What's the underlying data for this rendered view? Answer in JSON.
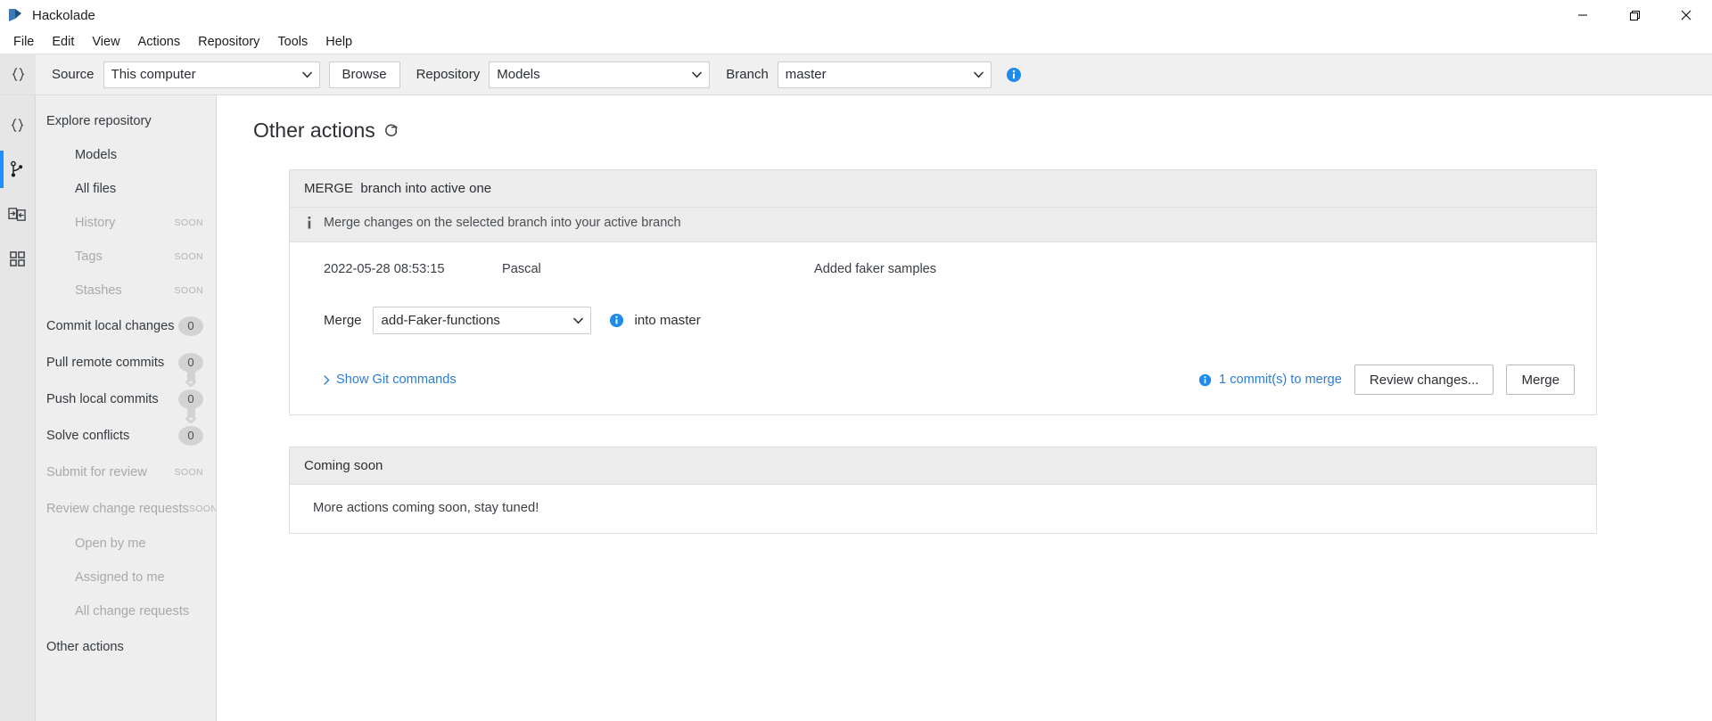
{
  "window": {
    "title": "Hackolade",
    "logo_icon": "hackolade-logo-icon",
    "controls": {
      "minimize": "minimize-icon",
      "maximize": "restore-icon",
      "close": "close-icon"
    }
  },
  "menubar": {
    "items": [
      {
        "label": "File"
      },
      {
        "label": "Edit"
      },
      {
        "label": "View"
      },
      {
        "label": "Actions"
      },
      {
        "label": "Repository"
      },
      {
        "label": "Tools"
      },
      {
        "label": "Help"
      }
    ]
  },
  "toolbar": {
    "rail_icon": "braces-icon",
    "source_label": "Source",
    "source_value": "This computer",
    "source_options": [
      "This computer"
    ],
    "browse_label": "Browse",
    "repository_label": "Repository",
    "repository_value": "Models",
    "repository_options": [
      "Models"
    ],
    "branch_label": "Branch",
    "branch_value": "master",
    "branch_options": [
      "master"
    ],
    "info_icon": "info-icon"
  },
  "rail": {
    "items": [
      {
        "icon": "braces-icon",
        "active": false
      },
      {
        "icon": "git-branch-icon",
        "active": true
      },
      {
        "icon": "import-export-icon",
        "active": false
      },
      {
        "icon": "grid-squares-icon",
        "active": false
      }
    ]
  },
  "sidebar": {
    "items": [
      {
        "label": "Explore repository",
        "level": 0,
        "disabled": false,
        "badge": null,
        "soon": null
      },
      {
        "label": "Models",
        "level": 1,
        "disabled": false,
        "badge": null,
        "soon": null
      },
      {
        "label": "All files",
        "level": 1,
        "disabled": false,
        "badge": null,
        "soon": null
      },
      {
        "label": "History",
        "level": 1,
        "disabled": true,
        "badge": null,
        "soon": "SOON"
      },
      {
        "label": "Tags",
        "level": 1,
        "disabled": true,
        "badge": null,
        "soon": "SOON"
      },
      {
        "label": "Stashes",
        "level": 1,
        "disabled": true,
        "badge": null,
        "soon": "SOON"
      },
      {
        "label": "Commit local changes",
        "level": 0,
        "disabled": false,
        "badge": "0",
        "soon": null
      },
      {
        "label": "Pull remote commits",
        "level": 0,
        "disabled": false,
        "badge": "0",
        "soon": null
      },
      {
        "label": "Push local commits",
        "level": 0,
        "disabled": false,
        "badge": "0",
        "soon": null
      },
      {
        "label": "Solve conflicts",
        "level": 0,
        "disabled": false,
        "badge": "0",
        "soon": null
      },
      {
        "label": "Submit for review",
        "level": 0,
        "disabled": true,
        "badge": null,
        "soon": "SOON"
      },
      {
        "label": "Review change requests",
        "level": 0,
        "disabled": true,
        "badge": null,
        "soon": "SOON"
      },
      {
        "label": "Open by me",
        "level": 2,
        "disabled": true,
        "badge": null,
        "soon": null
      },
      {
        "label": "Assigned to me",
        "level": 2,
        "disabled": true,
        "badge": null,
        "soon": null
      },
      {
        "label": "All change requests",
        "level": 2,
        "disabled": true,
        "badge": null,
        "soon": null
      },
      {
        "label": "Other actions",
        "level": 0,
        "disabled": false,
        "badge": null,
        "soon": null
      }
    ]
  },
  "main": {
    "page_title": "Other actions",
    "refresh_icon": "refresh-icon",
    "merge_panel": {
      "title_prefix": "MERGE",
      "title_rest": "branch into active one",
      "info_icon": "info-i-icon",
      "description": "Merge changes on the selected branch into your active branch",
      "commit": {
        "date": "2022-05-28 08:53:15",
        "author": "Pascal",
        "message": "Added faker samples"
      },
      "merge_label": "Merge",
      "merge_branch_value": "add-Faker-functions",
      "merge_branch_options": [
        "add-Faker-functions"
      ],
      "merge_info_icon": "info-icon",
      "into_text": "into master",
      "show_git_label": "Show Git commands",
      "commits_to_merge": "1 commit(s) to merge",
      "commits_info_icon": "info-icon",
      "review_button": "Review changes...",
      "merge_button": "Merge"
    },
    "coming_soon_panel": {
      "title": "Coming soon",
      "body": "More actions coming soon, stay tuned!"
    }
  },
  "colors": {
    "accent_blue": "#2b7cd3",
    "rail_active": "#1e90ff",
    "info_blue": "#1f8ceb",
    "sidebar_bg": "#eeeeee",
    "panel_head_bg": "#ececec",
    "badge_bg": "#d2d2d2"
  }
}
